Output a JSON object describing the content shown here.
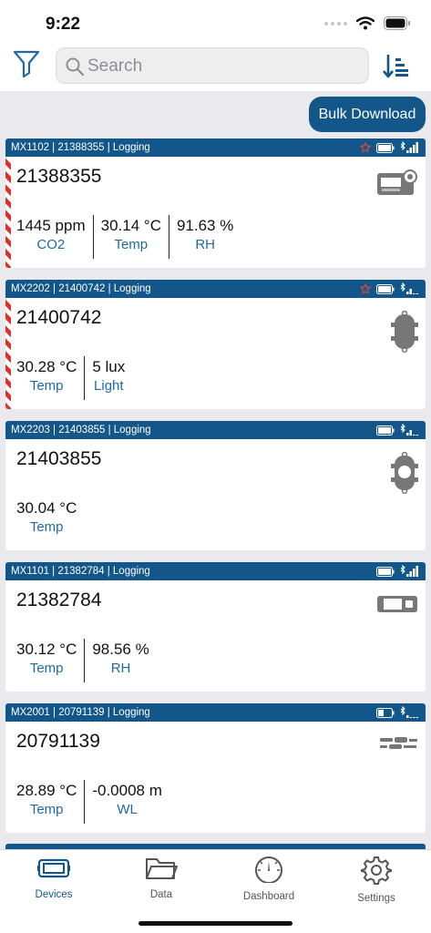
{
  "status": {
    "time": "9:22"
  },
  "search": {
    "placeholder": "Search"
  },
  "bulk_label": "Bulk Download",
  "devices": [
    {
      "header": "MX1102 | 21388355 | Logging",
      "serial": "21388355",
      "alarm": true,
      "device_icon": "mx1102-device-icon",
      "readings": [
        {
          "value": "1445 ppm",
          "label": "CO2"
        },
        {
          "value": "30.14 °C",
          "label": "Temp"
        },
        {
          "value": "91.63 %",
          "label": "RH"
        }
      ]
    },
    {
      "header": "MX2202 | 21400742 | Logging",
      "serial": "21400742",
      "alarm": true,
      "device_icon": "mx2202-device-icon",
      "readings": [
        {
          "value": "30.28 °C",
          "label": "Temp"
        },
        {
          "value": "5 lux",
          "label": "Light"
        }
      ]
    },
    {
      "header": "MX2203 | 21403855 | Logging",
      "serial": "21403855",
      "alarm": false,
      "device_icon": "mx2203-device-icon",
      "readings": [
        {
          "value": "30.04 °C",
          "label": "Temp"
        }
      ]
    },
    {
      "header": "MX1101 | 21382784 | Logging",
      "serial": "21382784",
      "alarm": false,
      "device_icon": "mx1101-device-icon",
      "readings": [
        {
          "value": "30.12 °C",
          "label": "Temp"
        },
        {
          "value": "98.56 %",
          "label": "RH"
        }
      ]
    },
    {
      "header": "MX2001 | 20791139 | Logging",
      "serial": "20791139",
      "alarm": false,
      "device_icon": "mx2001-device-icon",
      "readings": [
        {
          "value": "28.89 °C",
          "label": "Temp"
        },
        {
          "value": "-0.0008 m",
          "label": "WL"
        }
      ]
    }
  ],
  "tabs": [
    {
      "label": "Devices",
      "icon": "devices-icon",
      "active": true
    },
    {
      "label": "Data",
      "icon": "folder-icon",
      "active": false
    },
    {
      "label": "Dashboard",
      "icon": "gauge-icon",
      "active": false
    },
    {
      "label": "Settings",
      "icon": "gear-icon",
      "active": false
    }
  ],
  "colors": {
    "brand": "#13578a",
    "label": "#1f6aa5",
    "alarm": "#d9342b"
  }
}
